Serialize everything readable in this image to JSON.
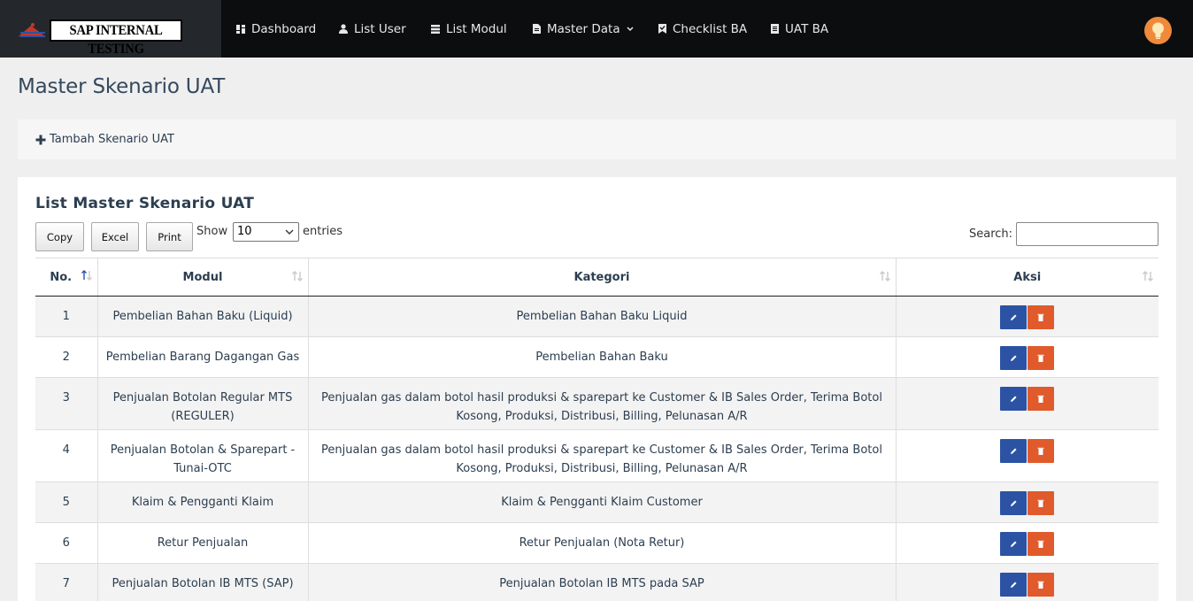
{
  "brand": {
    "title": "SAP INTERNAL TESTING"
  },
  "nav": {
    "items": [
      {
        "label": "Dashboard",
        "icon": "dashboard-icon"
      },
      {
        "label": "List User",
        "icon": "user-icon"
      },
      {
        "label": "List Modul",
        "icon": "list-icon"
      },
      {
        "label": "Master Data",
        "icon": "file-icon"
      },
      {
        "label": "Checklist BA",
        "icon": "bookmark-check-icon"
      },
      {
        "label": "UAT BA",
        "icon": "document-icon"
      }
    ],
    "avatar_icon": "lightbulb-icon"
  },
  "page": {
    "title": "Master Skenario UAT"
  },
  "add_panel": {
    "label": "Tambah Skenario UAT",
    "icon": "plus-icon"
  },
  "list": {
    "title": "List Master Skenario UAT",
    "buttons": {
      "copy": "Copy",
      "excel": "Excel",
      "print": "Print"
    },
    "show_label": "Show",
    "entries_value": "10",
    "entries_label": "entries",
    "search_label": "Search:",
    "search_value": "",
    "columns": {
      "no": "No.",
      "modul": "Modul",
      "kategori": "Kategori",
      "aksi": "Aksi"
    },
    "rows": [
      {
        "no": "1",
        "modul": "Pembelian Bahan Baku (Liquid)",
        "kategori": "Pembelian Bahan Baku Liquid"
      },
      {
        "no": "2",
        "modul": "Pembelian Barang Dagangan Gas",
        "kategori": "Pembelian Bahan Baku"
      },
      {
        "no": "3",
        "modul": "Penjualan Botolan Regular MTS (REGULER)",
        "kategori": "Penjualan gas dalam botol hasil produksi & sparepart ke Customer & IB Sales Order, Terima Botol Kosong, Produksi, Distribusi, Billing, Pelunasan A/R"
      },
      {
        "no": "4",
        "modul": "Penjualan Botolan & Sparepart - Tunai-OTC",
        "kategori": "Penjualan gas dalam botol hasil produksi & sparepart ke Customer & IB Sales Order, Terima Botol Kosong, Produksi, Distribusi, Billing, Pelunasan A/R"
      },
      {
        "no": "5",
        "modul": "Klaim & Pengganti Klaim",
        "kategori": "Klaim & Pengganti Klaim Customer"
      },
      {
        "no": "6",
        "modul": "Retur Penjualan",
        "kategori": "Retur Penjualan (Nota Retur)"
      },
      {
        "no": "7",
        "modul": "Penjualan Botolan IB MTS (SAP)",
        "kategori": "Penjualan Botolan IB MTS pada SAP"
      }
    ]
  },
  "colors": {
    "topbar": "#0c0d0f",
    "edit_button": "#2c53a3",
    "delete_button": "#e05a2b",
    "avatar": "#f08a3a"
  }
}
